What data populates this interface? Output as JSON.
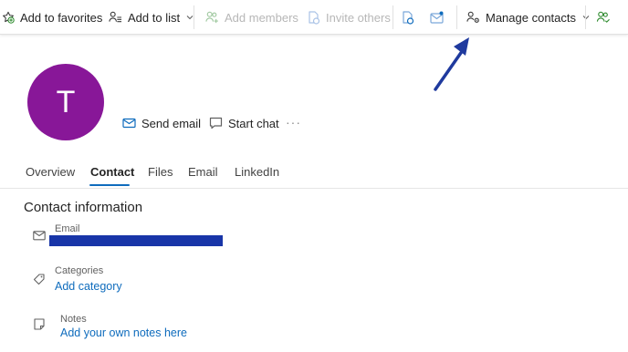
{
  "toolbar": {
    "add_to_favorites": "Add to favorites",
    "add_to_list": "Add to list",
    "add_members": "Add members",
    "invite_others": "Invite others",
    "manage_contacts": "Manage contacts"
  },
  "contact": {
    "avatar_initial": "T",
    "avatar_color": "#881798"
  },
  "actions": {
    "send_email": "Send email",
    "start_chat": "Start chat",
    "more": "···"
  },
  "tabs": [
    {
      "label": "Overview",
      "active": false
    },
    {
      "label": "Contact",
      "active": true
    },
    {
      "label": "Files",
      "active": false
    },
    {
      "label": "Email",
      "active": false
    },
    {
      "label": "LinkedIn",
      "active": false
    }
  ],
  "contact_info": {
    "title": "Contact information",
    "email_label": "Email",
    "categories_label": "Categories",
    "add_category": "Add category",
    "notes_label": "Notes",
    "add_notes": "Add your own notes here"
  },
  "colors": {
    "accent": "#0f6cbd",
    "redaction": "#1835a8",
    "annotation_arrow": "#1f3a9e"
  }
}
